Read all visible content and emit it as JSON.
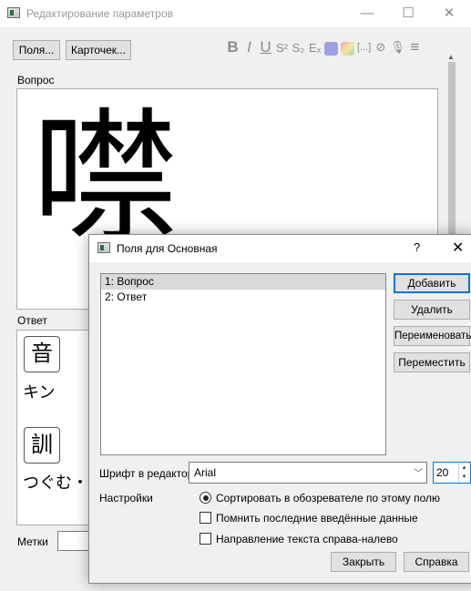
{
  "main_window": {
    "title": "Редактирование параметров",
    "controls": {
      "minimize": "—",
      "maximize": "☐",
      "close": "✕"
    },
    "buttons": {
      "fields": "Поля...",
      "cards": "Карточек..."
    },
    "format_toolbar": {
      "bold": "B",
      "italic": "I",
      "underline": "U",
      "superscript": "S²",
      "subscript": "S₂",
      "clear": "Eₓ",
      "cloze": "[...]",
      "attach": "⊘",
      "record": "🎙",
      "more": "≡"
    },
    "question_label": "Вопрос",
    "question_content": "噤",
    "answer_label": "Ответ",
    "answer_items": [
      {
        "kanji": "音",
        "reading": "キン"
      },
      {
        "kanji": "訓",
        "reading": "つぐむ・"
      }
    ],
    "tags_label": "Метки"
  },
  "dialog": {
    "title": "Поля для Основная",
    "help": "?",
    "close": "✕",
    "fields": [
      "1: Вопрос",
      "2: Ответ"
    ],
    "selected_index": 0,
    "buttons": {
      "add": "Добавить",
      "delete": "Удалить",
      "rename": "Переименовать",
      "reposition": "Переместить",
      "close": "Закрыть",
      "help": "Справка"
    },
    "font_label": "Шрифт в редакторе",
    "font_value": "Arial",
    "font_size": "20",
    "options_label": "Настройки",
    "options": {
      "sort": {
        "label": "Сортировать в обозревателе по этому полю",
        "checked": true
      },
      "remember": {
        "label": "Помнить последние введённые данные",
        "checked": false
      },
      "rtl": {
        "label": "Направление текста справа-налево",
        "checked": false
      }
    }
  }
}
